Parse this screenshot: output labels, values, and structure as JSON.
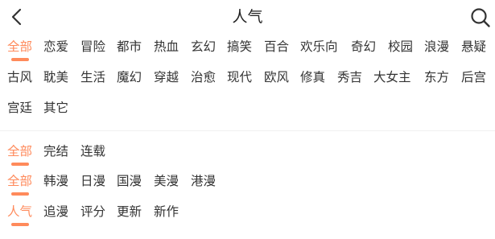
{
  "header": {
    "title": "人气"
  },
  "genre_filter": {
    "items": [
      "全部",
      "恋爱",
      "冒险",
      "都市",
      "热血",
      "玄幻",
      "搞笑",
      "百合",
      "欢乐向",
      "奇幻",
      "校园",
      "浪漫",
      "悬疑",
      "古风",
      "耽美",
      "生活",
      "魔幻",
      "穿越",
      "治愈",
      "现代",
      "欧风",
      "修真",
      "秀吉",
      "大女主",
      "东方",
      "后宫",
      "宫廷",
      "其它"
    ],
    "selected": "全部"
  },
  "status_filter": {
    "items": [
      "全部",
      "完结",
      "连载"
    ],
    "selected": "全部"
  },
  "region_filter": {
    "items": [
      "全部",
      "韩漫",
      "日漫",
      "国漫",
      "美漫",
      "港漫"
    ],
    "selected": "全部"
  },
  "sort_filter": {
    "items": [
      "人气",
      "追漫",
      "评分",
      "更新",
      "新作"
    ],
    "selected": "人气"
  },
  "colors": {
    "accent": "#ff8a5b",
    "text": "#333333"
  },
  "icons": {
    "back": "chevron-left-icon",
    "search": "search-icon"
  }
}
